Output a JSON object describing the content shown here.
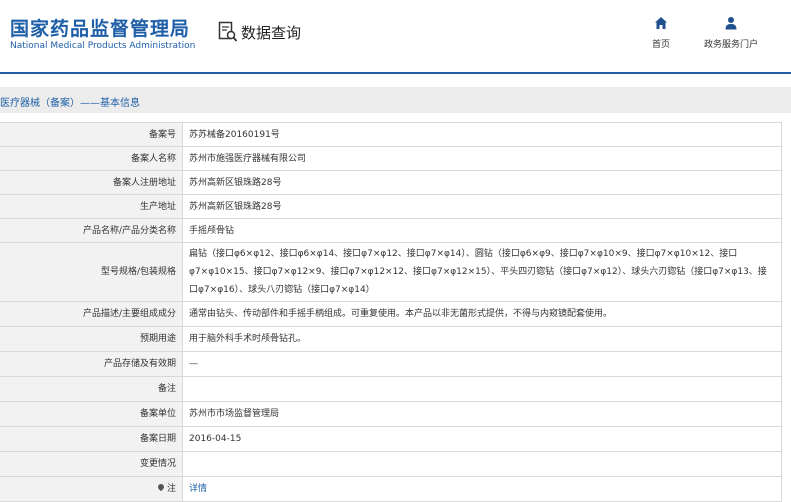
{
  "header": {
    "logo_cn": "国家药品监督管理局",
    "logo_en": "National Medical Products Administration",
    "query_label": "数据查询",
    "nav": [
      {
        "label": "首页",
        "icon": "home-icon"
      },
      {
        "label": "政务服务门户",
        "icon": "user-icon"
      }
    ]
  },
  "colors": {
    "brand": "#1f5fa8",
    "label_bg": "#f2f2f2",
    "section_bg": "#ececec"
  },
  "section": {
    "title": "医疗器械（备案）——基本信息"
  },
  "rows": [
    {
      "label": "备案号",
      "value": "苏苏械备20160191号"
    },
    {
      "label": "备案人名称",
      "value": "苏州市施强医疗器械有限公司"
    },
    {
      "label": "备案人注册地址",
      "value": "苏州高新区银珠路28号"
    },
    {
      "label": "生产地址",
      "value": "苏州高新区银珠路28号"
    },
    {
      "label": "产品名称/产品分类名称",
      "value": "手摇颅骨钻"
    },
    {
      "label": "型号规格/包装规格",
      "value": "扁钻（接口φ6×φ12、接口φ6×φ14、接口φ7×φ12、接口φ7×φ14）、圆钻（接口φ6×φ9、接口φ7×φ10×9、接口φ7×φ10×12、接口φ7×φ10×15、接口φ7×φ12×9、接口φ7×φ12×12、接口φ7×φ12×15）、平头四刃锪钻（接口φ7×φ12）、球头六刃锪钻（接口φ7×φ13、接口φ7×φ16）、球头八刃锪钻（接口φ7×φ14）"
    },
    {
      "label": "产品描述/主要组成成分",
      "value": "通常由钻头、传动部件和手摇手柄组成。可重复使用。本产品以非无菌形式提供，不得与内窥镜配套使用。"
    },
    {
      "label": "预期用途",
      "value": "用于脑外科手术时颅骨钻孔。"
    },
    {
      "label": "产品存储及有效期",
      "value": "—"
    },
    {
      "label": "备注",
      "value": ""
    },
    {
      "label": "备案单位",
      "value": "苏州市市场监督管理局"
    },
    {
      "label": "备案日期",
      "value": "2016-04-15"
    },
    {
      "label": "变更情况",
      "value": ""
    },
    {
      "label": "注",
      "value": "详情"
    }
  ]
}
